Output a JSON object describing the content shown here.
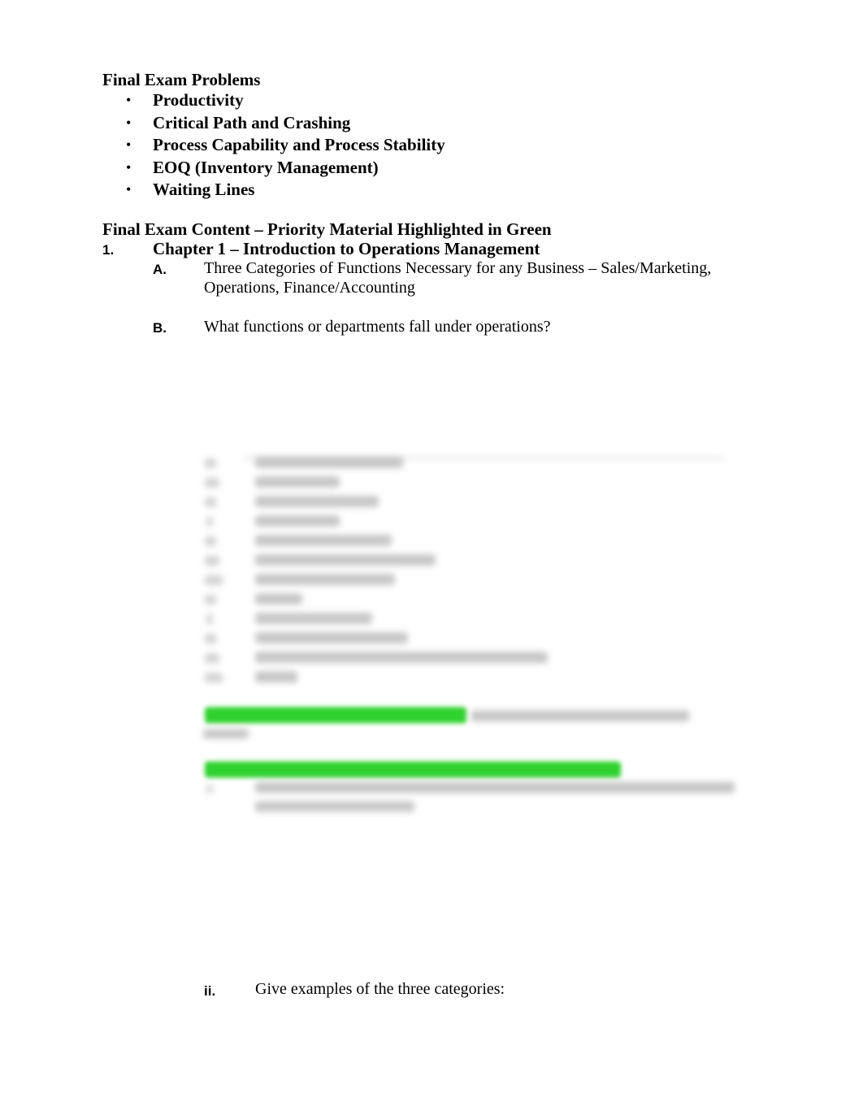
{
  "problems": {
    "heading": "Final Exam Problems",
    "bullet_glyph": "•",
    "items": [
      "Productivity",
      "Critical Path and Crashing",
      "Process Capability and Process Stability",
      "EOQ (Inventory Management)",
      "Waiting Lines"
    ]
  },
  "content": {
    "heading": "Final Exam Content – Priority Material Highlighted in Green",
    "chapter": {
      "number": "1.",
      "title": "Chapter 1 – Introduction to Operations Management"
    },
    "sections": [
      {
        "label": "A.",
        "text_line1": "Three Categories of Functions Necessary for any Business – Sales/Marketing,",
        "text_line2": "Operations, Finance/Accounting"
      },
      {
        "label": "B.",
        "text": "What functions or departments fall under operations?"
      }
    ],
    "blurred_region": {
      "note": "obscured preview",
      "blurred_list_items": 12,
      "highlight_color": "#2ed12e"
    },
    "subitem": {
      "label": "ii.",
      "text": "Give examples of the three categories:"
    }
  }
}
